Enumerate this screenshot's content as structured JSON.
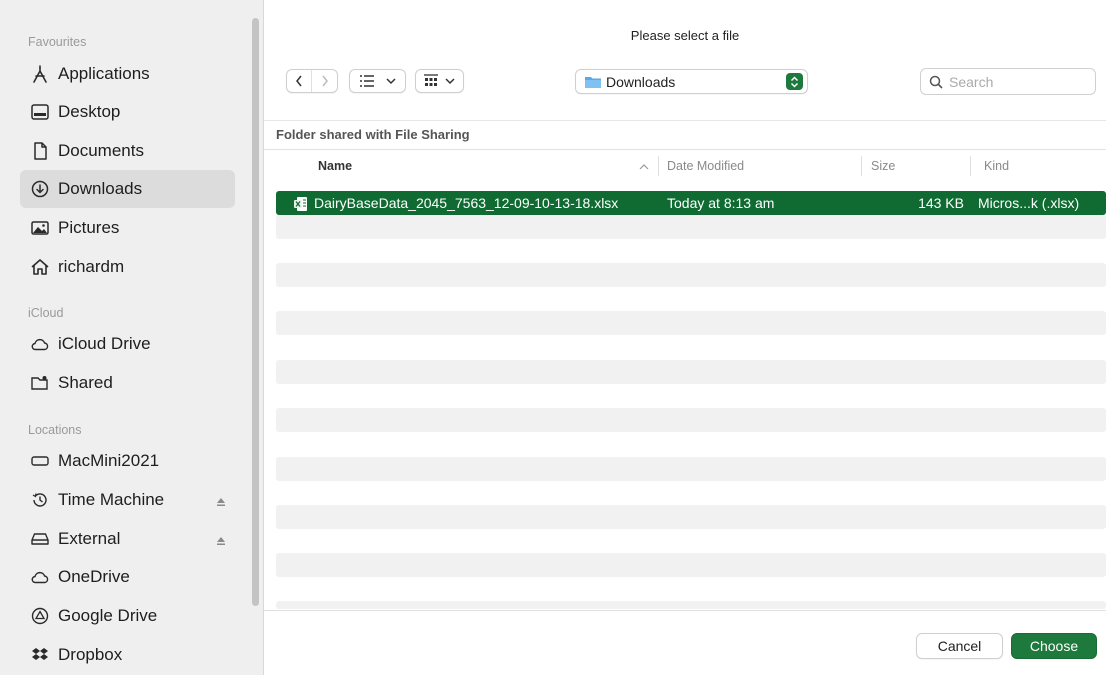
{
  "dialog": {
    "title": "Please select a file"
  },
  "sidebar": {
    "sections": [
      {
        "heading": "Favourites",
        "items": [
          {
            "label": "Applications",
            "icon": "applications-icon"
          },
          {
            "label": "Desktop",
            "icon": "desktop-icon"
          },
          {
            "label": "Documents",
            "icon": "document-icon"
          },
          {
            "label": "Downloads",
            "icon": "download-icon",
            "selected": true
          },
          {
            "label": "Pictures",
            "icon": "pictures-icon"
          },
          {
            "label": "richardm",
            "icon": "home-icon"
          }
        ]
      },
      {
        "heading": "iCloud",
        "items": [
          {
            "label": "iCloud Drive",
            "icon": "cloud-icon"
          },
          {
            "label": "Shared",
            "icon": "shared-folder-icon"
          }
        ]
      },
      {
        "heading": "Locations",
        "items": [
          {
            "label": "MacMini2021",
            "icon": "computer-icon"
          },
          {
            "label": "Time Machine",
            "icon": "time-machine-icon",
            "eject": true
          },
          {
            "label": "External",
            "icon": "drive-icon",
            "eject": true
          },
          {
            "label": "OneDrive",
            "icon": "cloud-icon"
          },
          {
            "label": "Google Drive",
            "icon": "google-drive-icon"
          },
          {
            "label": "Dropbox",
            "icon": "dropbox-icon"
          }
        ]
      }
    ]
  },
  "toolbar": {
    "location": "Downloads",
    "search_placeholder": "Search"
  },
  "browser": {
    "subheader": "Folder shared with File Sharing",
    "columns": {
      "name": "Name",
      "date": "Date Modified",
      "size": "Size",
      "kind": "Kind"
    },
    "files": [
      {
        "name": "DairyBaseData_2045_7563_12-09-10-13-18.xlsx",
        "date": "Today at 8:13 am",
        "size": "143 KB",
        "kind": "Micros...k (.xlsx)",
        "selected": true
      }
    ]
  },
  "buttons": {
    "cancel": "Cancel",
    "choose": "Choose"
  },
  "colors": {
    "accent": "#1e7a3c",
    "selection": "#0f6b31"
  }
}
